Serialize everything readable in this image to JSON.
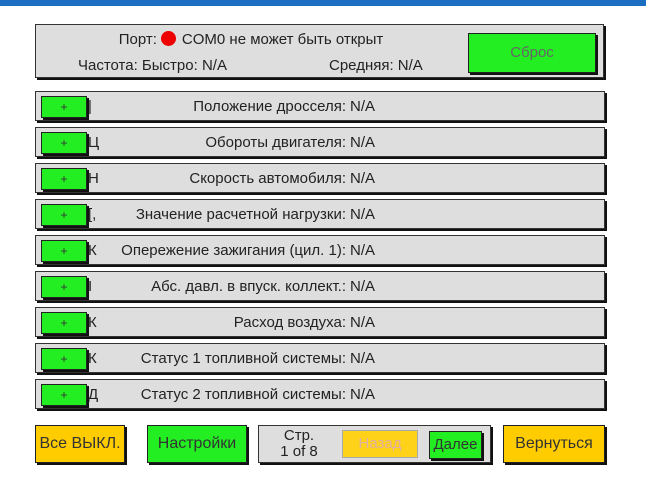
{
  "status": {
    "port_label": "Порт:",
    "port_message": "COM0 не может быть открыт",
    "freq_label": "Частота: Быстро: N/A",
    "avg_label": "Средняя: N/A",
    "reset_button": "Сброс",
    "indicator_color": "#ee0000"
  },
  "rows": [
    {
      "plus": "+",
      "frag": "|",
      "label": "Положение дросселя:",
      "value": "N/A"
    },
    {
      "plus": "+",
      "frag": "Ц",
      "label": "Обороты двигателя:",
      "value": "N/A"
    },
    {
      "plus": "+",
      "frag": "Н",
      "label": "Скорость автомобиля:",
      "value": "N/A"
    },
    {
      "plus": "+",
      "frag": "[,",
      "label": "Значение расчетной нагрузки:",
      "value": "N/A"
    },
    {
      "plus": "+",
      "frag": "К",
      "label": "Опережение зажигания (цил. 1):",
      "value": "N/A"
    },
    {
      "plus": "+",
      "frag": "I",
      "label": "Абс. давл. в впуск. коллект.:",
      "value": "N/A"
    },
    {
      "plus": "+",
      "frag": "К",
      "label": "Расход воздуха:",
      "value": "N/A"
    },
    {
      "plus": "+",
      "frag": "К",
      "label": "Статус 1 топливной системы:",
      "value": "N/A"
    },
    {
      "plus": "+",
      "frag": "Д",
      "label": "Статус 2 топливной системы:",
      "value": "N/A"
    }
  ],
  "footer": {
    "all_off": "Все ВЫКЛ.",
    "settings": "Настройки",
    "page_label": "Стр.",
    "page_value": "1 of 8",
    "back": "Назад",
    "next": "Далее",
    "return": "Вернуться"
  }
}
